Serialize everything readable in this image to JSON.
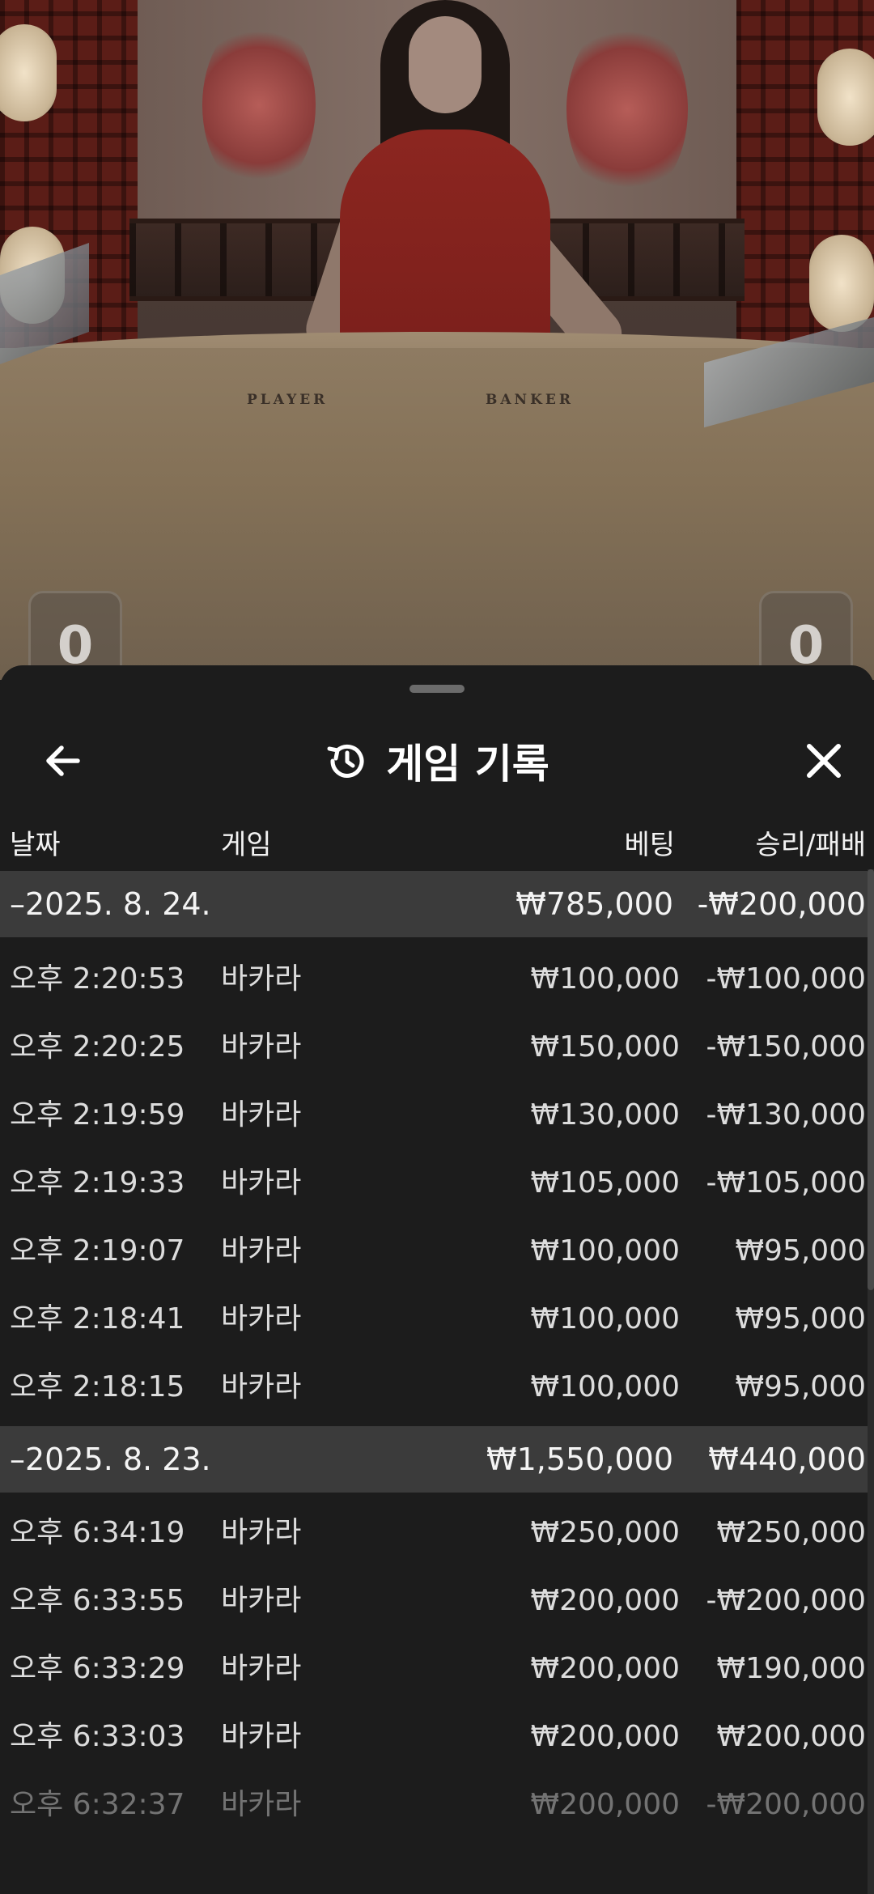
{
  "video": {
    "felt_player": "PLAYER",
    "felt_banker": "BANKER",
    "score_left": "0",
    "score_right": "0"
  },
  "sheet": {
    "title": "게임 기록",
    "icons": {
      "back": "arrow-left-icon",
      "history": "history-icon",
      "close": "close-icon"
    },
    "columns": {
      "date": "날짜",
      "game": "게임",
      "bet": "베팅",
      "win_loss": "승리/패배"
    },
    "groups": [
      {
        "date": "–2025. 8. 24.",
        "bet_total": "₩785,000",
        "result_total": "-₩200,000",
        "rows": [
          {
            "time": "오후 2:20:53",
            "game": "바카라",
            "bet": "₩100,000",
            "result": "-₩100,000"
          },
          {
            "time": "오후 2:20:25",
            "game": "바카라",
            "bet": "₩150,000",
            "result": "-₩150,000"
          },
          {
            "time": "오후 2:19:59",
            "game": "바카라",
            "bet": "₩130,000",
            "result": "-₩130,000"
          },
          {
            "time": "오후 2:19:33",
            "game": "바카라",
            "bet": "₩105,000",
            "result": "-₩105,000"
          },
          {
            "time": "오후 2:19:07",
            "game": "바카라",
            "bet": "₩100,000",
            "result": "₩95,000"
          },
          {
            "time": "오후 2:18:41",
            "game": "바카라",
            "bet": "₩100,000",
            "result": "₩95,000"
          },
          {
            "time": "오후 2:18:15",
            "game": "바카라",
            "bet": "₩100,000",
            "result": "₩95,000"
          }
        ]
      },
      {
        "date": "–2025. 8. 23.",
        "bet_total": "₩1,550,000",
        "result_total": "₩440,000",
        "rows": [
          {
            "time": "오후 6:34:19",
            "game": "바카라",
            "bet": "₩250,000",
            "result": "₩250,000"
          },
          {
            "time": "오후 6:33:55",
            "game": "바카라",
            "bet": "₩200,000",
            "result": "-₩200,000"
          },
          {
            "time": "오후 6:33:29",
            "game": "바카라",
            "bet": "₩200,000",
            "result": "₩190,000"
          },
          {
            "time": "오후 6:33:03",
            "game": "바카라",
            "bet": "₩200,000",
            "result": "₩200,000"
          },
          {
            "time": "오후 6:32:37",
            "game": "바카라",
            "bet": "₩200,000",
            "result": "-₩200,000"
          }
        ]
      }
    ]
  }
}
